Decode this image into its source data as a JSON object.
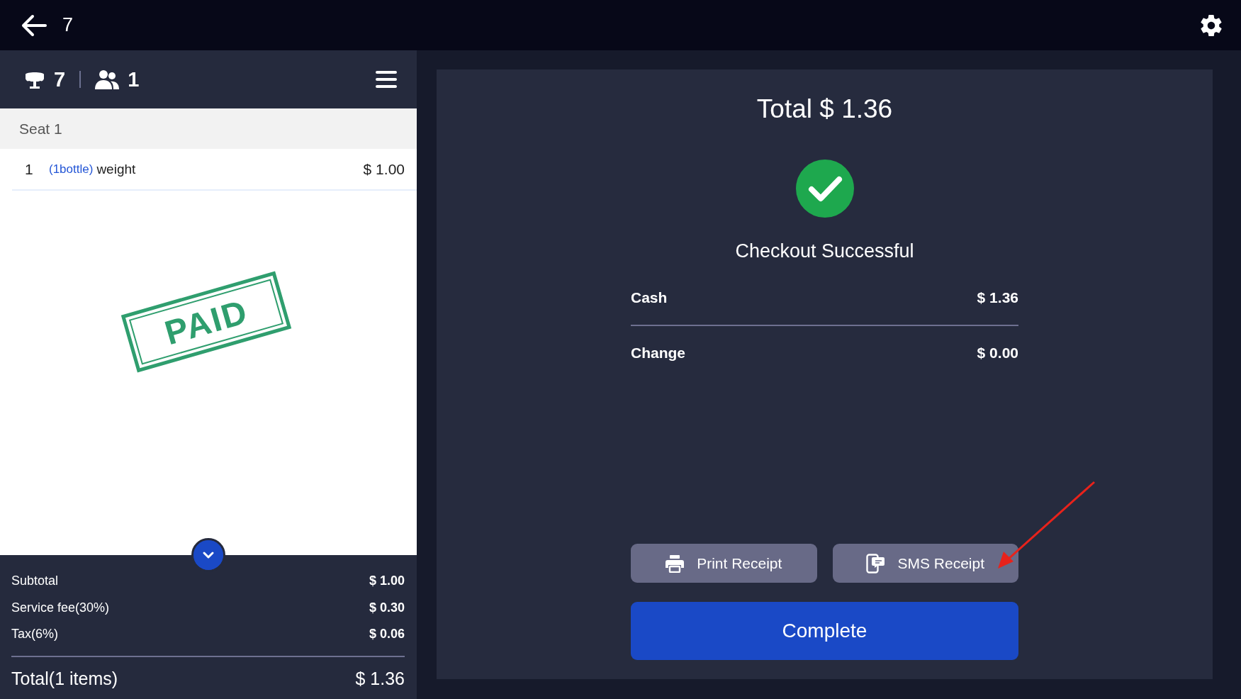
{
  "top_bar": {
    "title": "7"
  },
  "order": {
    "table": "7",
    "guests": "1",
    "seats": [
      {
        "label": "Seat 1",
        "items": [
          {
            "qty": "1",
            "modifier": "(1bottle)",
            "name": "weight",
            "price": "$ 1.00"
          }
        ]
      }
    ],
    "stamp": "PAID",
    "summary": [
      {
        "label": "Subtotal",
        "value": "$ 1.00"
      },
      {
        "label": "Service fee(30%)",
        "value": "$ 0.30"
      },
      {
        "label": "Tax(6%)",
        "value": "$ 0.06"
      }
    ],
    "total": {
      "label": "Total(1 items)",
      "value": "$ 1.36"
    }
  },
  "checkout": {
    "title": "Total $ 1.36",
    "status": "Checkout Successful",
    "payments": [
      {
        "label": "Cash",
        "value": "$ 1.36"
      },
      {
        "label": "Change",
        "value": "$ 0.00"
      }
    ],
    "buttons": [
      {
        "kind": "print",
        "label": "Print Receipt"
      },
      {
        "kind": "sms",
        "label": "SMS Receipt"
      }
    ],
    "primary": "Complete"
  }
}
